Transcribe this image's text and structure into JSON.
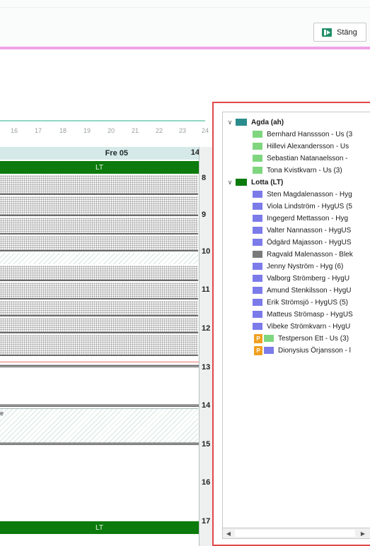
{
  "toolbar": {
    "close_label": "Stäng"
  },
  "calendar": {
    "day_numbers": [
      "16",
      "17",
      "18",
      "19",
      "20",
      "21",
      "22",
      "23",
      "24"
    ],
    "day_header": "Fre 05",
    "week_number": "14",
    "top_bar_label": "LT",
    "bottom_bar_label": "LT",
    "hours": [
      "8",
      "9",
      "10",
      "11",
      "12",
      "13",
      "14",
      "15",
      "16",
      "17"
    ],
    "fragment_text": "e"
  },
  "resource_tree": {
    "groups": [
      {
        "name": "Agda (ah)",
        "color": "#2a8c8c",
        "items": [
          {
            "label": "Bernhard Hanssson - Us (3",
            "color": "#7fd67f"
          },
          {
            "label": "Hillevi Alexandersson - Us",
            "color": "#7fd67f"
          },
          {
            "label": "Sebastian Natanaelsson -",
            "color": "#7fd67f"
          },
          {
            "label": "Tona Kvistkvarn - Us (3)",
            "color": "#7fd67f"
          }
        ]
      },
      {
        "name": "Lotta (LT)",
        "color": "#0c7a0c",
        "items": [
          {
            "label": "Sten Magdalenasson - Hyg",
            "color": "#7b7bea"
          },
          {
            "label": "Viola Lindström - HygUS (5",
            "color": "#7b7bea"
          },
          {
            "label": "Ingegerd Mettasson - Hyg",
            "color": "#7b7bea"
          },
          {
            "label": "Valter Nannasson - HygUS",
            "color": "#7b7bea"
          },
          {
            "label": "Ödgärd Majasson - HygUS",
            "color": "#7b7bea"
          },
          {
            "label": "Ragvald Malenasson - Blek",
            "color": "#7a7a7a"
          },
          {
            "label": "Jenny Nyström - Hyg (6)",
            "color": "#7b7bea"
          },
          {
            "label": "Valborg Strömberg - HygU",
            "color": "#7b7bea"
          },
          {
            "label": "Amund Stenkilsson - HygU",
            "color": "#7b7bea"
          },
          {
            "label": "Erik Strömsjö - HygUS (5)",
            "color": "#7b7bea"
          },
          {
            "label": "Matteus Strömasp - HygUS",
            "color": "#7b7bea"
          },
          {
            "label": "Vibeke Strömkvarn - HygU",
            "color": "#7b7bea"
          },
          {
            "label": "Testperson Ett - Us (3)",
            "color": "#7fd67f",
            "badge": "P"
          },
          {
            "label": "Dionysius Örjansson - l",
            "color": "#7b7bea",
            "badge": "P"
          }
        ]
      }
    ]
  }
}
